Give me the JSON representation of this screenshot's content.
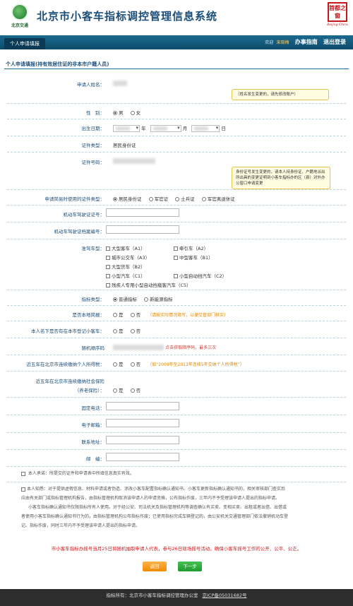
{
  "header": {
    "logo_text": "北京交通",
    "system_title": "北京市小客车指标调控管理信息系统",
    "brand_top": "首都之窗",
    "brand_en": "Beijing China"
  },
  "nav": {
    "tab": "个人申请填报",
    "welcome": "欢迎",
    "user": "宋晓梅",
    "guide": "办事指南",
    "logout": "退出登录"
  },
  "section_title": "个人申请填报(持有效居住证的非本市户籍人员)",
  "form": {
    "name_label": "申请人姓名：",
    "name_tip": "（姓名发生变更的，请先修改账户）",
    "gender_label": "性　别：",
    "gender_options": [
      "男",
      "女"
    ],
    "birth_label": "出生日期：",
    "birth_year_unit": "年",
    "birth_month_unit": "月",
    "birth_day_unit": "日",
    "id_type_label": "证件类型：",
    "id_type_value": "居民身份证",
    "id_number_label": "证件号码：",
    "id_tip": "身份证号发生变更的，请本人持身份证、户籍地派出所出具的变更证明到小客车指标办的区（县）对外办公窗口申请变更",
    "reg_type_label": "申请简易时使用的证件类型：",
    "reg_type_options": [
      "居民身份证",
      "军官证",
      "士兵证",
      "军官离退休证"
    ],
    "license_no_label": "机动车驾驶证证号：",
    "license_file_label": "机动车驾驶证档案编号：",
    "vehicle_class_label": "准驾车型：",
    "vehicle_classes": [
      "大型客车（A1）",
      "牵引车（A2）",
      "城市公交车（A3）",
      "中型客车（B1）",
      "大型货车（B2）",
      "小型汽车（C1）",
      "小型自动挡汽车（C2）",
      "残疾人专用小型自动挡载客汽车（C5）"
    ],
    "quota_type_label": "指标类型：",
    "quota_type_options": [
      "普通指标",
      "新能源指标"
    ],
    "local_reg_label": "是否本地简报：",
    "yes": "是",
    "no": "否",
    "local_reg_hint": "（请按实际情况填写，以便交管部门核实）",
    "has_car_label": "本人名下是否有在本市登记小客车：",
    "random_label": "随机顺序码",
    "random_hint": "点击获取顺序码，最多三次",
    "tax_label": "近五年在北京市连续缴纳个人所得税：",
    "tax_hint": "（如“2009年至2013年连续5年交纳个人所得税”）",
    "social_label": "近五年在北京市连续缴纳社会保险",
    "social_label2": "（养老保险）：",
    "phone_label": "固定电话：",
    "email_label": "电子邮箱：",
    "address_label": "联系地址：",
    "postcode_label": "邮　编："
  },
  "promise": "本人承诺：所提交的证件和申请表中所填信息真实有效。",
  "notice_lines": [
    "本人知悉：对于提供虚假信息、材料申请或者伪造、涂改小客车配置指标确认通知书、小客车更新指标确认通知书的，相关审核部门查实后",
    "应由有关部门或指标管理机构报告，由指标管理机构取消该申请人的申请资格，公布指标作废，三年内不予受理该申请人提出的指标申请。",
    "小客车指标确认通知书仅限指标所有人使用。对于经公安、司法机关及指标管理机构等调查确认有买卖、变相买卖、出租或者出借、出借或",
    "者使用小客车指标确认通知书行为的，由指标管理机构公布指标作废；已使用指标完成车辆登记的，由公安机关交通管理部门依法撤销机动车登",
    "记。指标作废，同时三年内不予受理该申请人提出的指标申请。"
  ],
  "red_notice": "市小客车指标办摇号当月25日将随机抽取申请人代表，参与26日现场摇号活动，确保小客车摇号工作的公开、公平、公正。",
  "buttons": {
    "back": "返回",
    "next": "下一步"
  },
  "footer": {
    "text": "指标所有：北京市小客车指标调控管理办公室",
    "icp": "京ICP备05031682号"
  },
  "colors": {
    "nav_bg": "#0d4c6b",
    "accent_blue": "#1a4e7a",
    "tip_bg": "#fffbe0",
    "red": "#d2191d",
    "back_btn": "#f08a00",
    "next_btn": "#1f9a2c"
  }
}
